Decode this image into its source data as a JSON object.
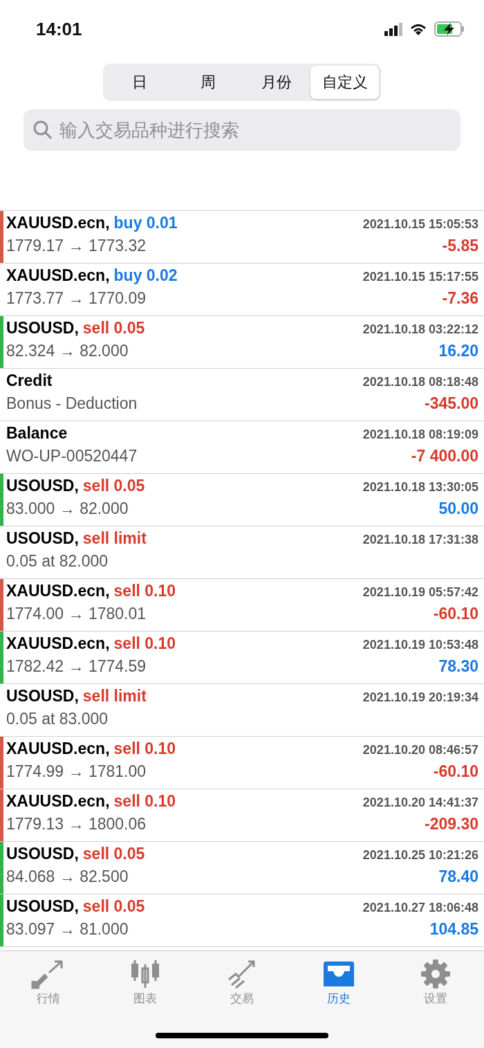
{
  "status_bar": {
    "time": "14:01"
  },
  "segments": [
    {
      "label": "日",
      "selected": false
    },
    {
      "label": "周",
      "selected": false
    },
    {
      "label": "月份",
      "selected": false
    },
    {
      "label": "自定义",
      "selected": true
    }
  ],
  "search": {
    "placeholder": "输入交易品种进行搜索"
  },
  "rows": [
    {
      "symbol": "XAUUSD.ecn,",
      "order": {
        "text": "buy 0.01",
        "kind": "buy"
      },
      "time": "2021.10.15 15:05:53",
      "detail": "1779.17 → 1773.32",
      "profit": {
        "text": "-5.85",
        "kind": "loss"
      },
      "color": "#d9574a"
    },
    {
      "symbol": "XAUUSD.ecn,",
      "order": {
        "text": "buy 0.02",
        "kind": "buy"
      },
      "time": "2021.10.15 15:17:55",
      "detail": "1773.77 → 1770.09",
      "profit": {
        "text": "-7.36",
        "kind": "loss"
      }
    },
    {
      "symbol": "USOUSD,",
      "order": {
        "text": "sell 0.05",
        "kind": "sell"
      },
      "time": "2021.10.18 03:22:12",
      "detail": "82.324 → 82.000",
      "profit": {
        "text": "16.20",
        "kind": "gain"
      },
      "color": "#2fb54a"
    },
    {
      "symbol": "Credit",
      "time": "2021.10.18 08:18:48",
      "detail": "Bonus - Deduction",
      "profit": {
        "text": "-345.00",
        "kind": "loss"
      }
    },
    {
      "symbol": "Balance",
      "time": "2021.10.18 08:19:09",
      "detail": "WO-UP-00520447",
      "profit": {
        "text": "-7 400.00",
        "kind": "loss"
      }
    },
    {
      "symbol": "USOUSD,",
      "order": {
        "text": "sell 0.05",
        "kind": "sell"
      },
      "time": "2021.10.18 13:30:05",
      "detail": "83.000 → 82.000",
      "profit": {
        "text": "50.00",
        "kind": "gain"
      },
      "color": "#2fb54a"
    },
    {
      "symbol": "USOUSD,",
      "order": {
        "text": "sell limit",
        "kind": "sell"
      },
      "time": "2021.10.18 17:31:38",
      "detail": "0.05 at 82.000"
    },
    {
      "symbol": "XAUUSD.ecn,",
      "order": {
        "text": "sell 0.10",
        "kind": "sell"
      },
      "time": "2021.10.19 05:57:42",
      "detail": "1774.00 → 1780.01",
      "profit": {
        "text": "-60.10",
        "kind": "loss"
      },
      "color": "#d9574a"
    },
    {
      "symbol": "XAUUSD.ecn,",
      "order": {
        "text": "sell 0.10",
        "kind": "sell"
      },
      "time": "2021.10.19 10:53:48",
      "detail": "1782.42 → 1774.59",
      "profit": {
        "text": "78.30",
        "kind": "gain"
      },
      "color": "#2fb54a"
    },
    {
      "symbol": "USOUSD,",
      "order": {
        "text": "sell limit",
        "kind": "sell"
      },
      "time": "2021.10.19 20:19:34",
      "detail": "0.05 at 83.000"
    },
    {
      "symbol": "XAUUSD.ecn,",
      "order": {
        "text": "sell 0.10",
        "kind": "sell"
      },
      "time": "2021.10.20 08:46:57",
      "detail": "1774.99 → 1781.00",
      "profit": {
        "text": "-60.10",
        "kind": "loss"
      },
      "color": "#d9574a"
    },
    {
      "symbol": "XAUUSD.ecn,",
      "order": {
        "text": "sell 0.10",
        "kind": "sell"
      },
      "time": "2021.10.20 14:41:37",
      "detail": "1779.13 → 1800.06",
      "profit": {
        "text": "-209.30",
        "kind": "loss"
      },
      "color": "#d9574a"
    },
    {
      "symbol": "USOUSD,",
      "order": {
        "text": "sell 0.05",
        "kind": "sell"
      },
      "time": "2021.10.25 10:21:26",
      "detail": "84.068 → 82.500",
      "profit": {
        "text": "78.40",
        "kind": "gain"
      },
      "color": "#2fb54a"
    },
    {
      "symbol": "USOUSD,",
      "order": {
        "text": "sell 0.05",
        "kind": "sell"
      },
      "time": "2021.10.27 18:06:48",
      "detail": "83.097 → 81.000",
      "profit": {
        "text": "104.85",
        "kind": "gain"
      },
      "color": "#2fb54a"
    }
  ],
  "tab_bar": [
    {
      "label": "行情",
      "selected": false
    },
    {
      "label": "图表",
      "selected": false
    },
    {
      "label": "交易",
      "selected": false
    },
    {
      "label": "历史",
      "selected": true
    },
    {
      "label": "设置",
      "selected": false
    }
  ]
}
